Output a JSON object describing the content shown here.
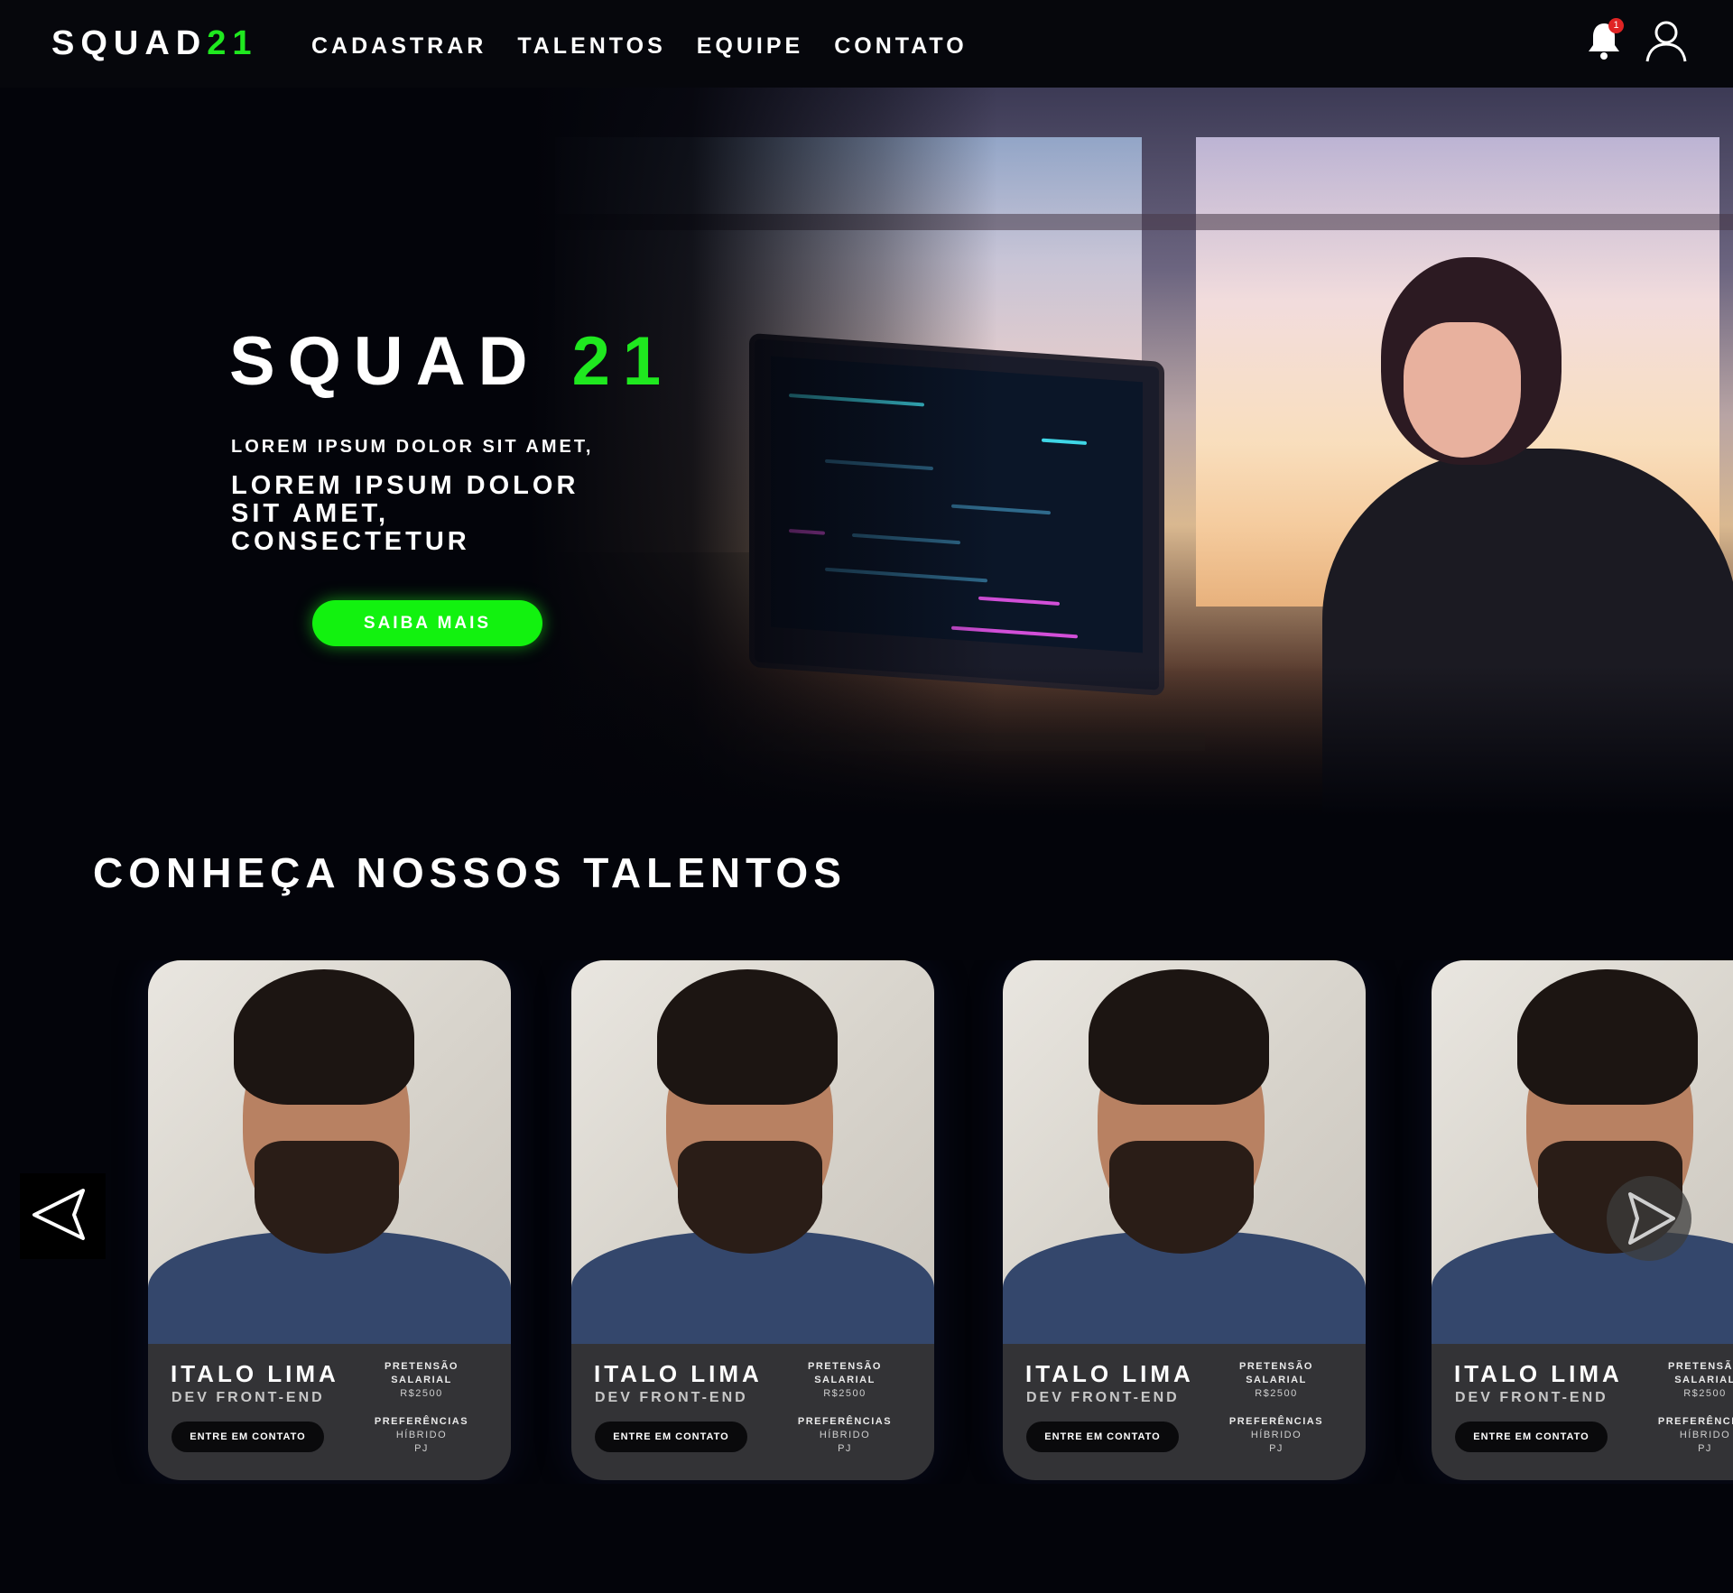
{
  "brand": {
    "name_white": "SQUAD",
    "name_green": "21"
  },
  "nav": {
    "items": [
      {
        "label": "CADASTRAR"
      },
      {
        "label": "TALENTOS"
      },
      {
        "label": "EQUIPE"
      },
      {
        "label": "CONTATO"
      }
    ],
    "notification_count": "1",
    "icons": [
      "bell-icon",
      "user-icon"
    ]
  },
  "hero": {
    "title_white": "SQUAD",
    "title_green": "21",
    "subtitle": "LOREM IPSUM DOLOR SIT AMET,",
    "description": "LOREM IPSUM DOLOR SIT AMET, CONSECTETUR",
    "cta_label": "SAIBA MAIS"
  },
  "talents": {
    "title": "CONHEÇA NOSSOS TALENTOS",
    "cards": [
      {
        "name": "ITALO LIMA",
        "role": "DEV FRONT-END",
        "salary_label": "PRETENSÃO SALARIAL",
        "salary": "R$2500",
        "prefs_label": "PREFERÊNCIAS",
        "pref1": "HÍBRIDO",
        "pref2": "PJ",
        "button": "ENTRE EM CONTATO"
      },
      {
        "name": "ITALO LIMA",
        "role": "DEV FRONT-END",
        "salary_label": "PRETENSÃO SALARIAL",
        "salary": "R$2500",
        "prefs_label": "PREFERÊNCIAS",
        "pref1": "HÍBRIDO",
        "pref2": "PJ",
        "button": "ENTRE EM CONTATO"
      },
      {
        "name": "ITALO LIMA",
        "role": "DEV FRONT-END",
        "salary_label": "PRETENSÃO SALARIAL",
        "salary": "R$2500",
        "prefs_label": "PREFERÊNCIAS",
        "pref1": "HÍBRIDO",
        "pref2": "PJ",
        "button": "ENTRE EM CONTATO"
      },
      {
        "name": "ITALO LIMA",
        "role": "DEV FRONT-END",
        "salary_label": "PRETENSÃO SALARIAL",
        "salary": "R$2500",
        "prefs_label": "PREFERÊNCIAS",
        "pref1": "HÍBRIDO",
        "pref2": "PJ",
        "button": "ENTRE EM CONTATO"
      }
    ],
    "controls": [
      "arrow-left-icon",
      "arrow-right-icon"
    ]
  },
  "colors": {
    "accent": "#1fe81f",
    "button_green": "#12f20f",
    "background": "#03040a",
    "card": "#333336",
    "badge": "#e02424"
  }
}
